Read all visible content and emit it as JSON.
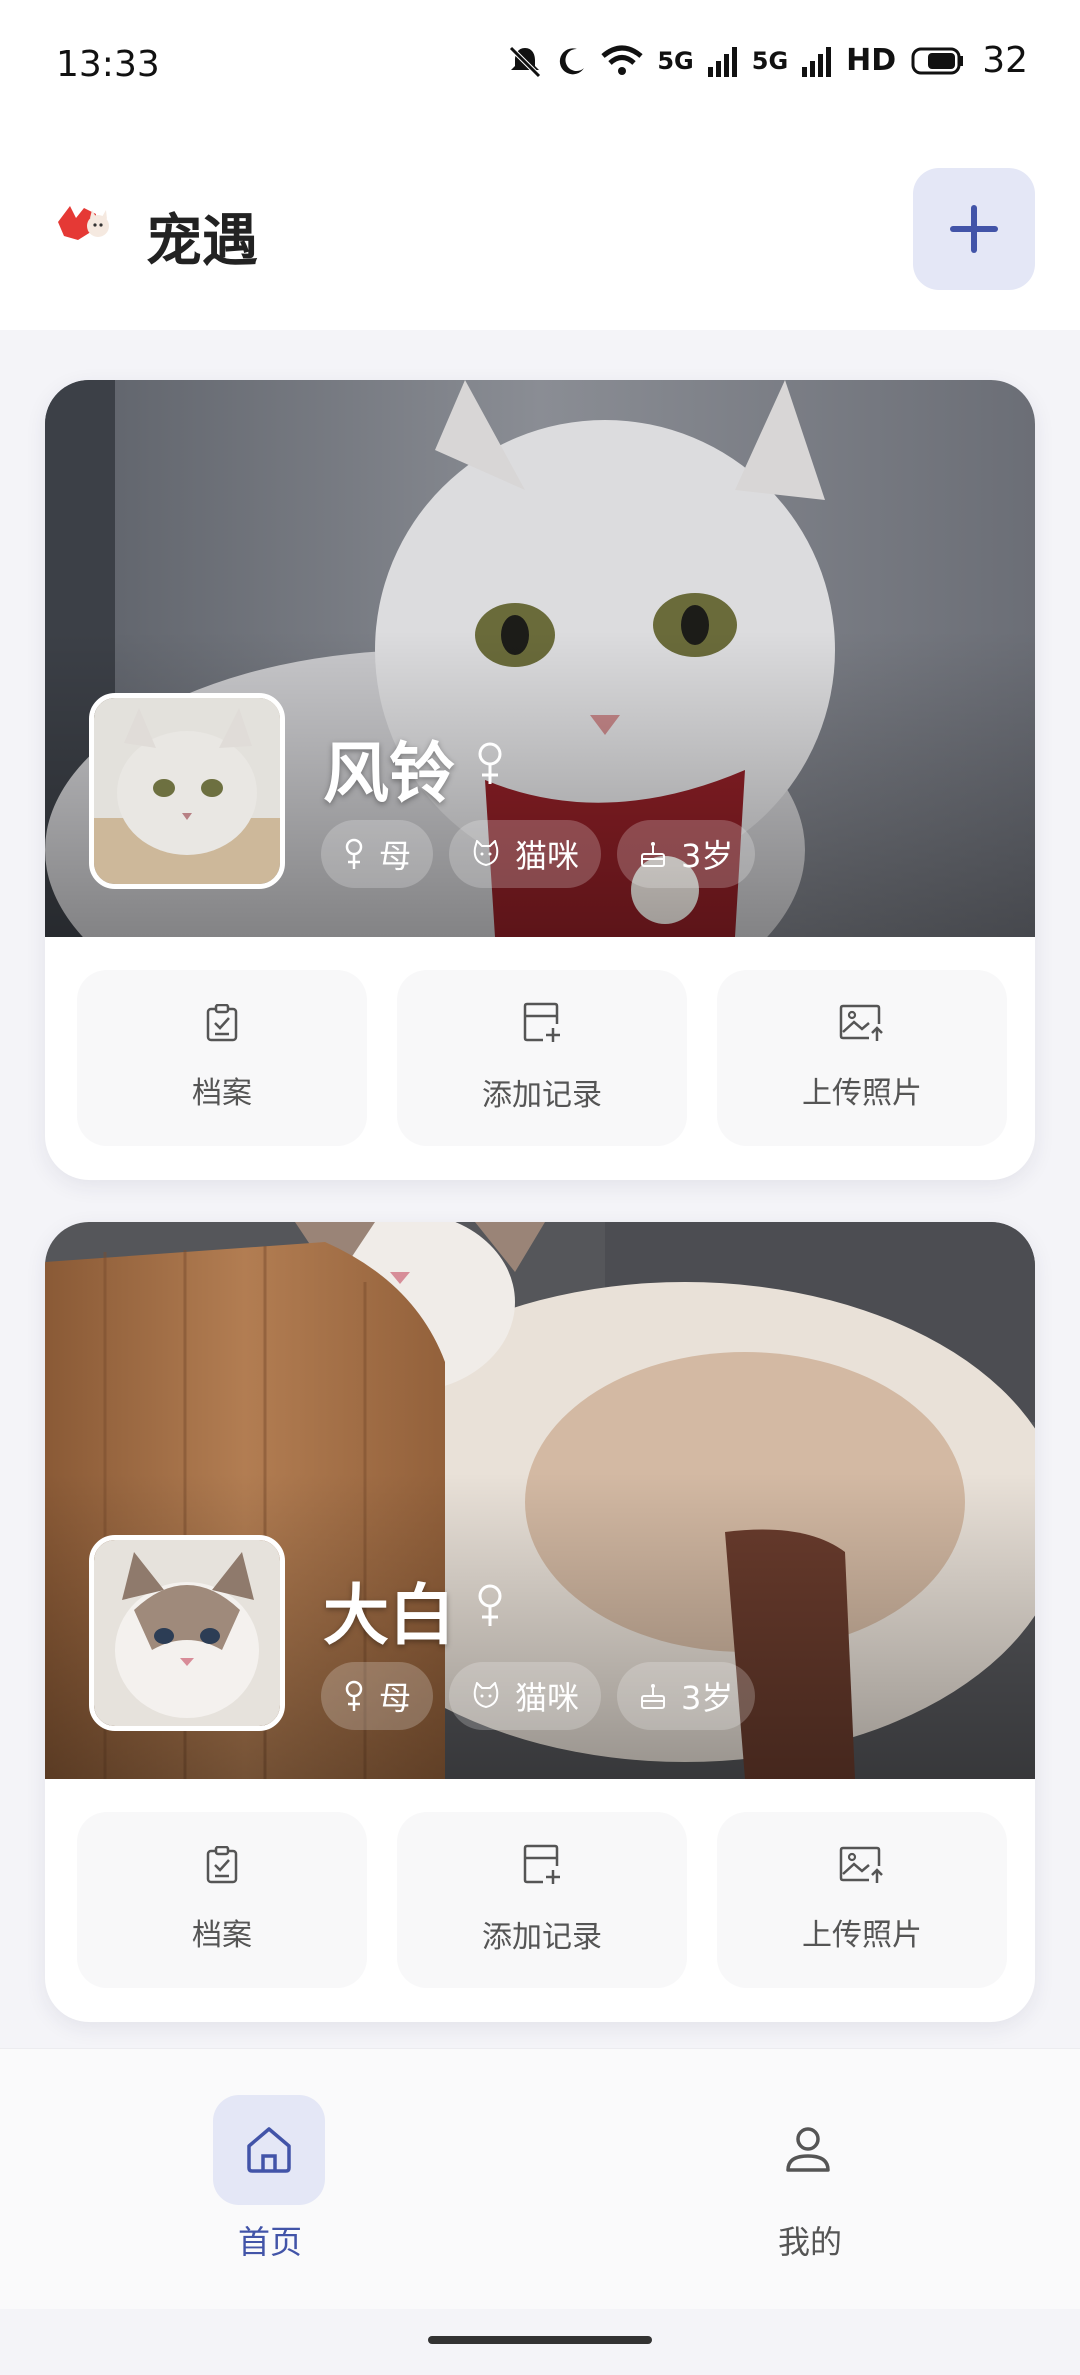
{
  "status_bar": {
    "time": "13:33",
    "network_1": "5G",
    "network_2": "5G",
    "hd": "HD",
    "battery": "32"
  },
  "header": {
    "title": "宠遇",
    "add_icon": "plus-icon",
    "logo_icon": "cat-bat-logo"
  },
  "pets": [
    {
      "name": "风铃",
      "gender_symbol": "♀",
      "tags": {
        "gender": "母",
        "species": "猫咪",
        "age": "3岁"
      },
      "actions": {
        "profile": "档案",
        "add_record": "添加记录",
        "upload_photo": "上传照片"
      }
    },
    {
      "name": "大白",
      "gender_symbol": "♀",
      "tags": {
        "gender": "母",
        "species": "猫咪",
        "age": "3岁"
      },
      "actions": {
        "profile": "档案",
        "add_record": "添加记录",
        "upload_photo": "上传照片"
      }
    }
  ],
  "bottom_nav": {
    "home": "首页",
    "mine": "我的"
  },
  "colors": {
    "accent": "#4254a8",
    "accent_bg": "#e4e7f6",
    "page_bg": "#f4f4f8"
  }
}
